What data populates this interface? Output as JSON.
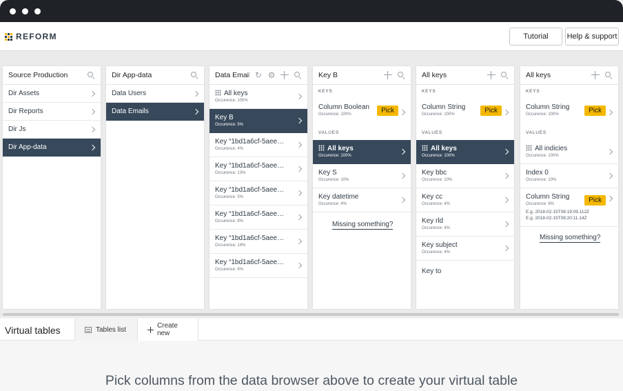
{
  "app": {
    "brand": "REFORM"
  },
  "header": {
    "tutorial_label": "Tutorial",
    "help_label": "Help & support"
  },
  "columns": {
    "source": {
      "title": "Source Production",
      "items": [
        {
          "label": "Dir Assets"
        },
        {
          "label": "Dir Reports"
        },
        {
          "label": "Dir Js"
        },
        {
          "label": "Dir App-data",
          "selected": true
        }
      ]
    },
    "appdata": {
      "title": "Dir App-data",
      "items": [
        {
          "label": "Data Users"
        },
        {
          "label": "Data Emails",
          "selected": true
        }
      ]
    },
    "emails": {
      "title": "Data Emails",
      "items": [
        {
          "name": "All keys",
          "occurrence": "Occurence: 100%"
        },
        {
          "name": "Key B",
          "occurrence": "Occurence: 5%",
          "selected": true
        },
        {
          "name": "Key “1bd1a6cf-5aee…",
          "occurrence": "Occurence: 4%"
        },
        {
          "name": "Key “1bd1a6cf-5aee…",
          "occurrence": "Occurence: 13%"
        },
        {
          "name": "Key “1bd1a6cf-5aee…",
          "occurrence": "Occurence: 5%"
        },
        {
          "name": "Key “1bd1a6cf-5aee…",
          "occurrence": "Occurence: 8%"
        },
        {
          "name": "Key “1bd1a6cf-5aee…",
          "occurrence": "Occurence: 14%"
        },
        {
          "name": "Key “1bd1a6cf-5aee…",
          "occurrence": "Occurence: 6%"
        }
      ]
    },
    "keyb": {
      "title": "Key B",
      "keys_label": "KEYS",
      "values_label": "VALUES",
      "key": {
        "name": "Column Boolean",
        "occurrence": "Occurence: 100%",
        "pick": "Pick"
      },
      "values": [
        {
          "name": "All keys",
          "occurrence": "Occurence: 100%",
          "selected": true
        },
        {
          "name": "Key S",
          "occurrence": "Occurence: 10%"
        },
        {
          "name": "Key datetime",
          "occurrence": "Occurence: 4%"
        }
      ],
      "missing": "Missing something?"
    },
    "allkeys1": {
      "title": "All keys",
      "keys_label": "KEYS",
      "values_label": "VALUES",
      "key": {
        "name": "Column String",
        "occurrence": "Occurence: 100%",
        "pick": "Pick"
      },
      "values": [
        {
          "name": "All keys",
          "occurrence": "Occurence: 100%",
          "selected": true
        },
        {
          "name": "Key bbc",
          "occurrence": "Occurence: 10%"
        },
        {
          "name": "Key cc",
          "occurrence": "Occurence: 4%"
        },
        {
          "name": "Key rld",
          "occurrence": "Occurence: 4%"
        },
        {
          "name": "Key subject",
          "occurrence": "Occurence: 4%"
        },
        {
          "name": "Key to",
          "occurrence": ""
        }
      ]
    },
    "allkeys2": {
      "title": "All keys",
      "keys_label": "KEYS",
      "values_label": "VALUES",
      "key": {
        "name": "Column String",
        "occurrence": "Occurence: 100%",
        "pick": "Pick"
      },
      "values": [
        {
          "name": "All indicies",
          "occurrence": "Occurence: 100%"
        },
        {
          "name": "Index 0",
          "occurrence": "Occurence: 10%"
        }
      ],
      "string": {
        "name": "Column String",
        "occurrence": "Occurence: 6%",
        "pick": "Pick",
        "examples": [
          "E.g. 2018-02-15T08:19:09.112Z",
          "E.g. 2018-02-15T08:20:11.14Z"
        ]
      },
      "missing": "Missing something?"
    }
  },
  "virtual_tables": {
    "title": "Virtual tables",
    "tabs": [
      {
        "label": "Tables list"
      },
      {
        "label": "Create new"
      }
    ],
    "hint": "Pick columns from the data browser above to create your virtual table"
  },
  "colors": {
    "selected": "#36485a",
    "pick": "#f5b800",
    "titlebar": "#1f2328"
  }
}
